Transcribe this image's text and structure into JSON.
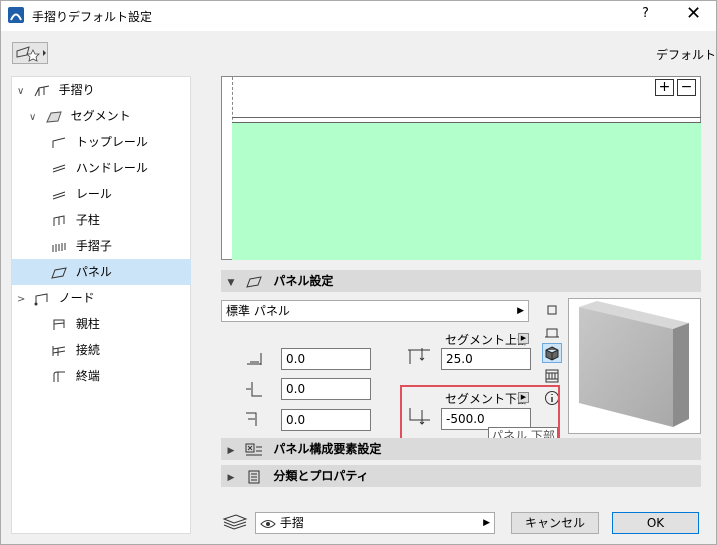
{
  "window": {
    "title": "手摺りデフォルト設定",
    "help": "?",
    "close": "✕",
    "default_label": "デフォルト"
  },
  "tree": [
    {
      "label": "手摺り",
      "arrow": "∨"
    },
    {
      "label": "セグメント",
      "arrow": "∨"
    },
    {
      "label": "トップレール"
    },
    {
      "label": "ハンドレール"
    },
    {
      "label": "レール"
    },
    {
      "label": "子柱"
    },
    {
      "label": "手摺子"
    },
    {
      "label": "パネル",
      "selected": true
    },
    {
      "label": "ノード",
      "arrow": ">"
    },
    {
      "label": "親柱"
    },
    {
      "label": "接続"
    },
    {
      "label": "終端"
    }
  ],
  "preview": {
    "zoom_in": "+",
    "zoom_out": "−"
  },
  "panel_settings": {
    "title": "パネル設定",
    "type_combo": "標準 パネル",
    "segment_top_label": "セグメント上部",
    "segment_top_value": "25.0",
    "segment_bottom_label": "セグメント下部",
    "segment_bottom_value": "-500.0",
    "offset1": "0.0",
    "offset2": "0.0",
    "offset3": "0.0",
    "tooltip": "パネル 下部"
  },
  "sections": {
    "components": "パネル構成要素設定",
    "classification": "分類とプロパティ"
  },
  "footer": {
    "layer": "手摺",
    "cancel": "キャンセル",
    "ok": "OK"
  },
  "colors": {
    "preview_fill": "#b3ffcc",
    "highlight": "#e0505a",
    "selection": "#cce4f7"
  }
}
